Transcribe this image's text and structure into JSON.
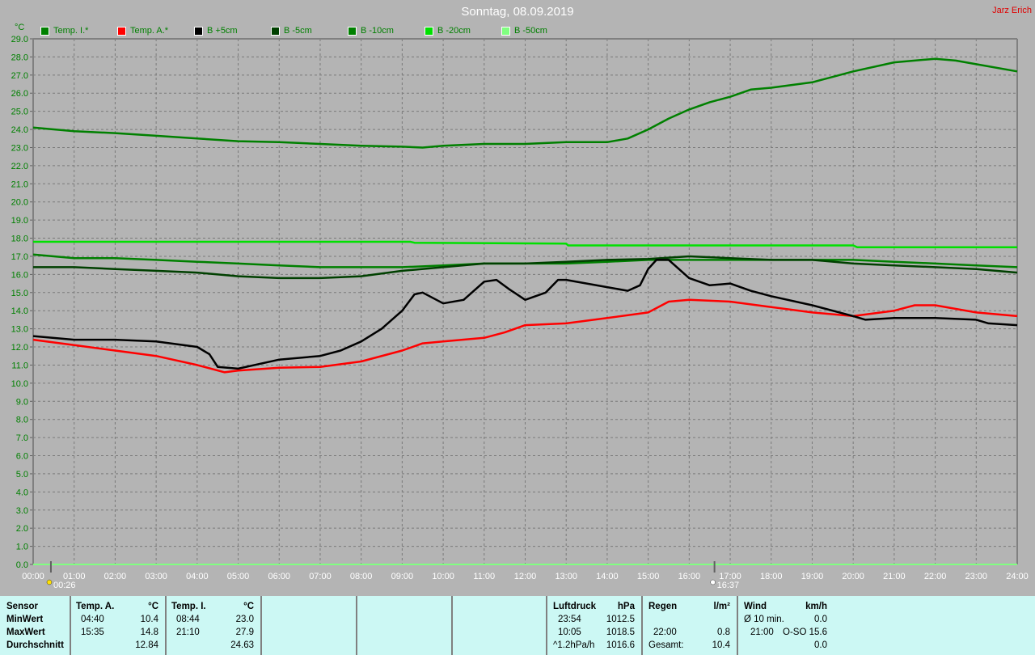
{
  "header": {
    "title": "Sonntag, 08.09.2019",
    "author": "Jarz Erich"
  },
  "chart_data": {
    "type": "line",
    "title": "Sonntag, 08.09.2019",
    "ylabel": "°C",
    "xlabel": "",
    "ylim": [
      0,
      29
    ],
    "xlim": [
      0,
      24
    ],
    "grid": true,
    "legend_placement": "top",
    "yticks": [
      "0.0",
      "1.0",
      "2.0",
      "3.0",
      "4.0",
      "5.0",
      "6.0",
      "7.0",
      "8.0",
      "9.0",
      "10.0",
      "11.0",
      "12.0",
      "13.0",
      "14.0",
      "15.0",
      "16.0",
      "17.0",
      "18.0",
      "19.0",
      "20.0",
      "21.0",
      "22.0",
      "23.0",
      "24.0",
      "25.0",
      "26.0",
      "27.0",
      "28.0",
      "29.0"
    ],
    "xticks": [
      "00:00",
      "01:00",
      "02:00",
      "03:00",
      "04:00",
      "05:00",
      "06:00",
      "07:00",
      "08:00",
      "09:00",
      "10:00",
      "11:00",
      "12:00",
      "13:00",
      "14:00",
      "15:00",
      "16:00",
      "17:00",
      "18:00",
      "19:00",
      "20:00",
      "21:00",
      "22:00",
      "23:00",
      "24:00"
    ],
    "markers": [
      {
        "label": "00:26",
        "hour": 0.433,
        "icon": "sunrise-icon"
      },
      {
        "label": "16:37",
        "hour": 16.617,
        "icon": "sunset-icon"
      }
    ],
    "series": [
      {
        "name": "B -50cm",
        "color": "#80ff80",
        "points": [
          [
            0,
            0
          ],
          [
            24,
            0
          ]
        ]
      },
      {
        "name": "B -20cm",
        "color": "#00e000",
        "points": [
          [
            0,
            17.8
          ],
          [
            9.2,
            17.8
          ],
          [
            9.3,
            17.75
          ],
          [
            13,
            17.7
          ],
          [
            13.05,
            17.6
          ],
          [
            20,
            17.6
          ],
          [
            20.1,
            17.5
          ],
          [
            24,
            17.5
          ]
        ]
      },
      {
        "name": "B -10cm",
        "color": "#008000",
        "points": [
          [
            0,
            17.1
          ],
          [
            1,
            16.9
          ],
          [
            2,
            16.9
          ],
          [
            3,
            16.8
          ],
          [
            4,
            16.7
          ],
          [
            5,
            16.6
          ],
          [
            6,
            16.5
          ],
          [
            7,
            16.4
          ],
          [
            8,
            16.4
          ],
          [
            9,
            16.4
          ],
          [
            10,
            16.5
          ],
          [
            11,
            16.6
          ],
          [
            12,
            16.6
          ],
          [
            13,
            16.6
          ],
          [
            14,
            16.7
          ],
          [
            15,
            16.8
          ],
          [
            16,
            16.8
          ],
          [
            17,
            16.8
          ],
          [
            18,
            16.8
          ],
          [
            19,
            16.8
          ],
          [
            20,
            16.8
          ],
          [
            21,
            16.7
          ],
          [
            22,
            16.6
          ],
          [
            23,
            16.5
          ],
          [
            24,
            16.4
          ]
        ]
      },
      {
        "name": "B -5cm",
        "color": "#004000",
        "points": [
          [
            0,
            16.4
          ],
          [
            1,
            16.4
          ],
          [
            2,
            16.3
          ],
          [
            3,
            16.2
          ],
          [
            4,
            16.1
          ],
          [
            5,
            15.9
          ],
          [
            6,
            15.8
          ],
          [
            7,
            15.8
          ],
          [
            8,
            15.9
          ],
          [
            9,
            16.2
          ],
          [
            10,
            16.4
          ],
          [
            11,
            16.6
          ],
          [
            12,
            16.6
          ],
          [
            13,
            16.7
          ],
          [
            14,
            16.8
          ],
          [
            15,
            16.85
          ],
          [
            16,
            17.0
          ],
          [
            17,
            16.9
          ],
          [
            18,
            16.8
          ],
          [
            19,
            16.8
          ],
          [
            20,
            16.6
          ],
          [
            21,
            16.5
          ],
          [
            22,
            16.4
          ],
          [
            23,
            16.3
          ],
          [
            24,
            16.1
          ]
        ]
      },
      {
        "name": "Temp. I.*",
        "color": "#008000",
        "points": [
          [
            0,
            24.1
          ],
          [
            1,
            23.9
          ],
          [
            2,
            23.8
          ],
          [
            3,
            23.65
          ],
          [
            4,
            23.5
          ],
          [
            5,
            23.35
          ],
          [
            6,
            23.3
          ],
          [
            7,
            23.2
          ],
          [
            8,
            23.1
          ],
          [
            9,
            23.05
          ],
          [
            9.5,
            23.0
          ],
          [
            10,
            23.1
          ],
          [
            11,
            23.2
          ],
          [
            12,
            23.2
          ],
          [
            13,
            23.3
          ],
          [
            14,
            23.3
          ],
          [
            14.5,
            23.5
          ],
          [
            15,
            24.0
          ],
          [
            15.5,
            24.6
          ],
          [
            16,
            25.1
          ],
          [
            16.5,
            25.5
          ],
          [
            17,
            25.8
          ],
          [
            17.5,
            26.2
          ],
          [
            18,
            26.3
          ],
          [
            19,
            26.6
          ],
          [
            20,
            27.2
          ],
          [
            21,
            27.7
          ],
          [
            22,
            27.9
          ],
          [
            22.5,
            27.8
          ],
          [
            23,
            27.6
          ],
          [
            24,
            27.2
          ]
        ]
      },
      {
        "name": "Temp. A.*",
        "color": "#ff0000",
        "points": [
          [
            0,
            12.4
          ],
          [
            1,
            12.1
          ],
          [
            2,
            11.8
          ],
          [
            3,
            11.5
          ],
          [
            4,
            11.0
          ],
          [
            4.67,
            10.6
          ],
          [
            5,
            10.7
          ],
          [
            6,
            10.85
          ],
          [
            7,
            10.9
          ],
          [
            8,
            11.2
          ],
          [
            9,
            11.8
          ],
          [
            9.5,
            12.2
          ],
          [
            10,
            12.3
          ],
          [
            11,
            12.5
          ],
          [
            11.5,
            12.8
          ],
          [
            12,
            13.2
          ],
          [
            13,
            13.3
          ],
          [
            14,
            13.6
          ],
          [
            15,
            13.9
          ],
          [
            15.5,
            14.5
          ],
          [
            16,
            14.6
          ],
          [
            17,
            14.5
          ],
          [
            18,
            14.2
          ],
          [
            19,
            13.9
          ],
          [
            20,
            13.7
          ],
          [
            21,
            14.0
          ],
          [
            21.5,
            14.3
          ],
          [
            22,
            14.3
          ],
          [
            23,
            13.9
          ],
          [
            24,
            13.7
          ]
        ]
      },
      {
        "name": "B +5cm",
        "color": "#000000",
        "points": [
          [
            0,
            12.6
          ],
          [
            1,
            12.4
          ],
          [
            2,
            12.4
          ],
          [
            3,
            12.3
          ],
          [
            4,
            12.0
          ],
          [
            4.3,
            11.6
          ],
          [
            4.5,
            10.9
          ],
          [
            5,
            10.8
          ],
          [
            6,
            11.3
          ],
          [
            7,
            11.5
          ],
          [
            7.5,
            11.8
          ],
          [
            8,
            12.3
          ],
          [
            8.5,
            13.0
          ],
          [
            9,
            14.0
          ],
          [
            9.3,
            14.9
          ],
          [
            9.5,
            15.0
          ],
          [
            10,
            14.4
          ],
          [
            10.5,
            14.6
          ],
          [
            11,
            15.6
          ],
          [
            11.3,
            15.7
          ],
          [
            11.6,
            15.2
          ],
          [
            12,
            14.6
          ],
          [
            12.5,
            15.0
          ],
          [
            12.8,
            15.7
          ],
          [
            13,
            15.7
          ],
          [
            13.5,
            15.5
          ],
          [
            14,
            15.3
          ],
          [
            14.5,
            15.1
          ],
          [
            14.8,
            15.4
          ],
          [
            15,
            16.3
          ],
          [
            15.2,
            16.8
          ],
          [
            15.5,
            16.8
          ],
          [
            16,
            15.8
          ],
          [
            16.5,
            15.4
          ],
          [
            17,
            15.5
          ],
          [
            17.5,
            15.1
          ],
          [
            18,
            14.8
          ],
          [
            19,
            14.3
          ],
          [
            20,
            13.7
          ],
          [
            20.3,
            13.5
          ],
          [
            21,
            13.6
          ],
          [
            22,
            13.6
          ],
          [
            23,
            13.5
          ],
          [
            23.3,
            13.3
          ],
          [
            24,
            13.2
          ]
        ]
      }
    ]
  },
  "legend": [
    {
      "label": "Temp. I.*",
      "color": "#008000"
    },
    {
      "label": "Temp. A.*",
      "color": "#ff0000"
    },
    {
      "label": "B +5cm",
      "color": "#000000"
    },
    {
      "label": "B -5cm",
      "color": "#004000"
    },
    {
      "label": "B -10cm",
      "color": "#008000"
    },
    {
      "label": "B -20cm",
      "color": "#00e000"
    },
    {
      "label": "B -50cm",
      "color": "#80ff80"
    }
  ],
  "table": {
    "sensor": {
      "h": "Sensor",
      "min": "MinWert",
      "max": "MaxWert",
      "avg": "Durchschnitt"
    },
    "temp_a": {
      "h": "Temp. A.",
      "unit": "°C",
      "min_t": "04:40",
      "min": "10.4",
      "max_t": "15:35",
      "max": "14.8",
      "avg": "12.84"
    },
    "temp_i": {
      "h": "Temp. I.",
      "unit": "°C",
      "min_t": "08:44",
      "min": "23.0",
      "max_t": "21:10",
      "max": "27.9",
      "avg": "24.63"
    },
    "pressure": {
      "h": "Luftdruck",
      "unit": "hPa",
      "min_t": "23:54",
      "min": "1012.5",
      "max_t": "10:05",
      "max": "1018.5",
      "trend": "^1.2hPa/h",
      "cur": "1016.6"
    },
    "rain": {
      "h": "Regen",
      "unit": "l/m²",
      "max_t": "22:00",
      "max": "0.8",
      "total_l": "Gesamt:",
      "total": "10.4"
    },
    "wind": {
      "h": "Wind",
      "unit": "km/h",
      "avg_l": "Ø 10 min.",
      "avg": "0.0",
      "max_t": "21:00",
      "max": "O-SO 15.6",
      "cur": "0.0"
    }
  }
}
